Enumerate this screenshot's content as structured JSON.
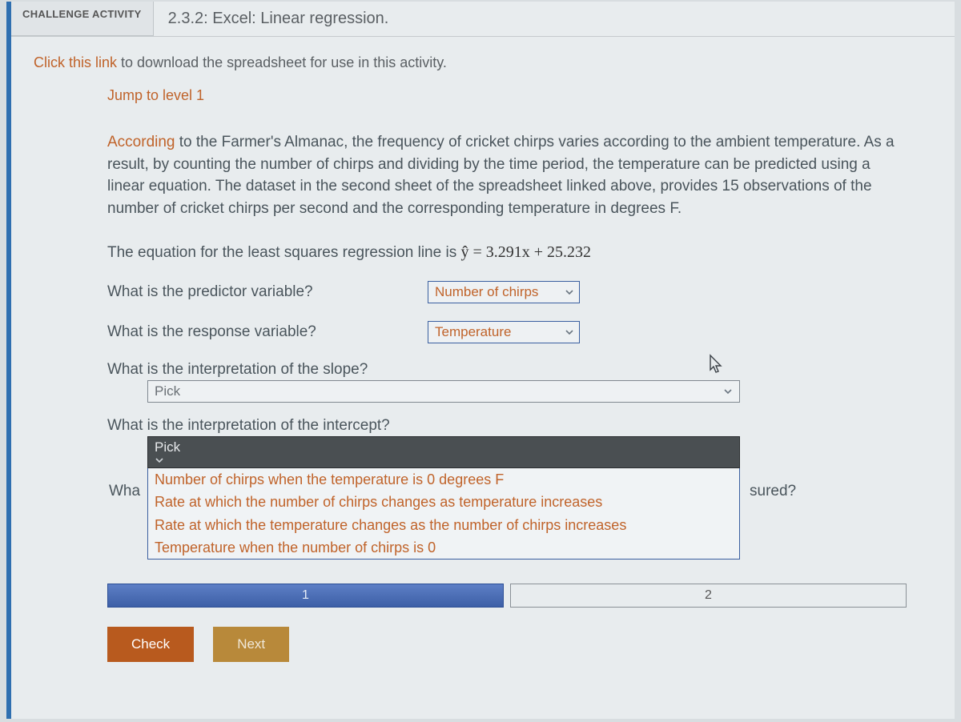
{
  "header": {
    "badge": "CHALLENGE ACTIVITY",
    "title": "2.3.2: Excel: Linear regression."
  },
  "linkRow": {
    "linkText": "Click this link",
    "rest": " to download the spreadsheet for use in this activity."
  },
  "jump": "Jump to level 1",
  "paragraph": {
    "lead": "According",
    "rest": " to the Farmer's Almanac, the frequency of cricket chirps varies according to the ambient temperature. As a result, by counting the number of chirps and dividing by the time period, the temperature can be predicted using a linear equation. The dataset in the second sheet of the spreadsheet linked above, provides 15 observations of the number of cricket chirps per second and the corresponding temperature in degrees F."
  },
  "equation": {
    "pre": "The equation for the least squares regression line is ",
    "math": "ŷ = 3.291x + 25.232"
  },
  "q1": {
    "label": "What is the predictor variable?",
    "value": "Number of chirps"
  },
  "q2": {
    "label": "What is the response variable?",
    "value": "Temperature"
  },
  "q3": {
    "label": "What is the interpretation of the slope?",
    "value": "Pick"
  },
  "q4": {
    "label": "What is the interpretation of the intercept?",
    "value": "Pick",
    "options": [
      "Number of chirps when the temperature is 0 degrees F",
      "Rate at which the number of chirps changes as temperature increases",
      "Rate at which the temperature changes as the number of chirps increases",
      "Temperature when the number of chirps is 0"
    ]
  },
  "hidden": {
    "left": "Wha",
    "right": "sured?"
  },
  "progress": {
    "step1": "1",
    "step2": "2"
  },
  "buttons": {
    "check": "Check",
    "next": "Next"
  }
}
